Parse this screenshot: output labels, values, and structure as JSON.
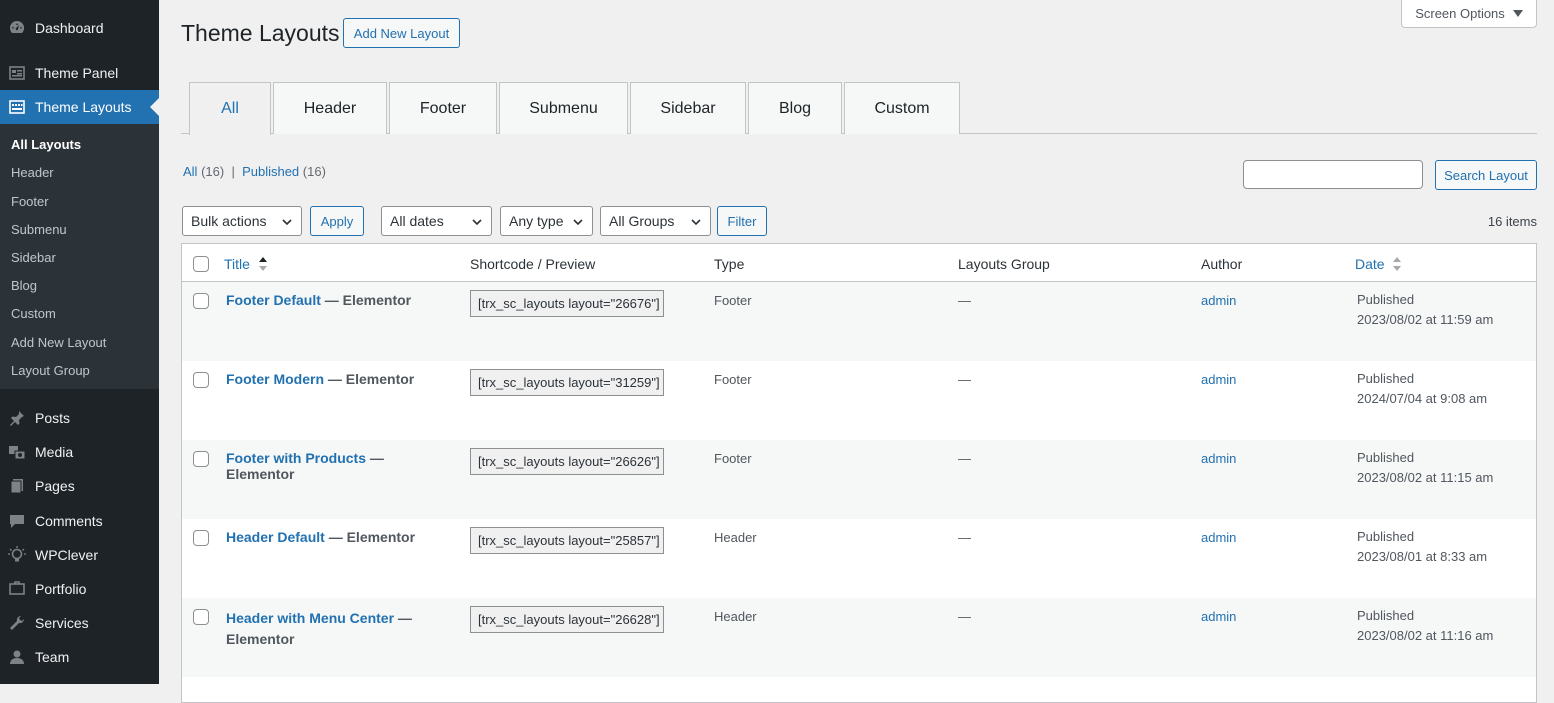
{
  "sidebar": {
    "top_items": [
      {
        "label": "Dashboard",
        "icon": "dashboard-icon"
      },
      {
        "label": "Theme Panel",
        "icon": "theme-panel-icon"
      },
      {
        "label": "Theme Layouts",
        "icon": "theme-layouts-icon"
      }
    ],
    "submenu": [
      {
        "label": "All Layouts"
      },
      {
        "label": "Header"
      },
      {
        "label": "Footer"
      },
      {
        "label": "Submenu"
      },
      {
        "label": "Sidebar"
      },
      {
        "label": "Blog"
      },
      {
        "label": "Custom"
      },
      {
        "label": "Add New Layout"
      },
      {
        "label": "Layout Group"
      }
    ],
    "bottom_items": [
      {
        "label": "Posts",
        "icon": "pin-icon"
      },
      {
        "label": "Media",
        "icon": "media-icon"
      },
      {
        "label": "Pages",
        "icon": "pages-icon"
      },
      {
        "label": "Comments",
        "icon": "comment-icon"
      },
      {
        "label": "WPClever",
        "icon": "wpclever-icon"
      },
      {
        "label": "Portfolio",
        "icon": "portfolio-icon"
      },
      {
        "label": "Services",
        "icon": "wrench-icon"
      },
      {
        "label": "Team",
        "icon": "person-icon"
      }
    ]
  },
  "header": {
    "title": "Theme Layouts",
    "add_new_label": "Add New Layout",
    "screen_options_label": "Screen Options"
  },
  "tabs": [
    "All",
    "Header",
    "Footer",
    "Submenu",
    "Sidebar",
    "Blog",
    "Custom"
  ],
  "views": {
    "all_label": "All",
    "all_count": "(16)",
    "separator": "|",
    "published_label": "Published",
    "published_count": "(16)"
  },
  "search": {
    "value": "",
    "button_label": "Search Layout"
  },
  "filters": {
    "bulk_actions": "Bulk actions",
    "apply_label": "Apply",
    "dates": "All dates",
    "type": "Any type",
    "groups": "All Groups",
    "filter_label": "Filter"
  },
  "items_count": "16 items",
  "table": {
    "columns": [
      "Title",
      "Shortcode / Preview",
      "Type",
      "Layouts Group",
      "Author",
      "Date"
    ],
    "rows": [
      {
        "title": "Footer Default",
        "suffix": " — Elementor",
        "shortcode": "[trx_sc_layouts layout=\"26676\"]",
        "type": "Footer",
        "group": "—",
        "author": "admin",
        "status": "Published",
        "date": "2023/08/02 at 11:59 am"
      },
      {
        "title": "Footer Modern",
        "suffix": " — Elementor",
        "shortcode": "[trx_sc_layouts layout=\"31259\"]",
        "type": "Footer",
        "group": "—",
        "author": "admin",
        "status": "Published",
        "date": "2024/07/04 at 9:08 am"
      },
      {
        "title": "Footer with Products",
        "suffix": " — Elementor",
        "shortcode": "[trx_sc_layouts layout=\"26626\"]",
        "type": "Footer",
        "group": "—",
        "author": "admin",
        "status": "Published",
        "date": "2023/08/02 at 11:15 am"
      },
      {
        "title": "Header Default",
        "suffix": " — Elementor",
        "shortcode": "[trx_sc_layouts layout=\"25857\"]",
        "type": "Header",
        "group": "—",
        "author": "admin",
        "status": "Published",
        "date": "2023/08/01 at 8:33 am"
      },
      {
        "title": "Header with Menu Center",
        "suffix": " — Elementor",
        "shortcode": "[trx_sc_layouts layout=\"26628\"]",
        "type": "Header",
        "group": "—",
        "author": "admin",
        "status": "Published",
        "date": "2023/08/02 at 11:16 am"
      }
    ]
  },
  "colors": {
    "accent": "#2271b1",
    "sidebar_bg": "#1d2327",
    "submenu_bg": "#2c3338"
  }
}
